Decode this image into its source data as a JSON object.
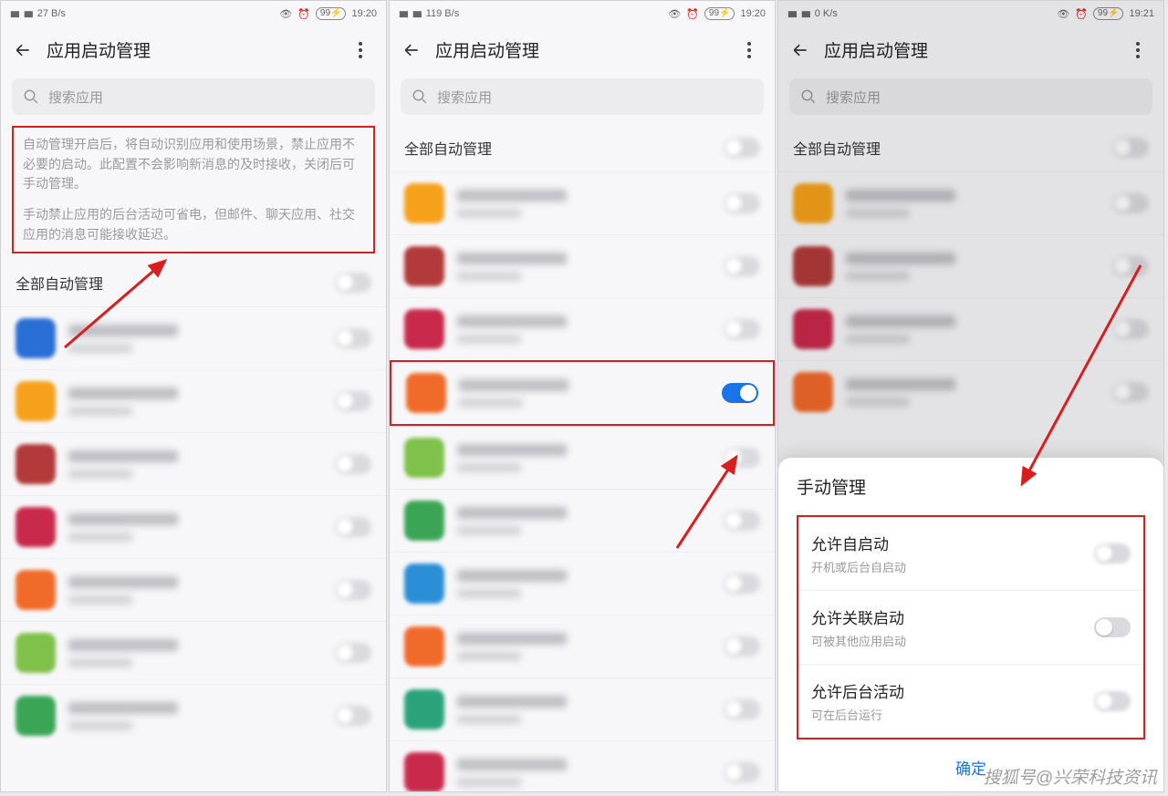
{
  "statusbar": {
    "net_speed_a": "27 B/s",
    "net_speed_b": "119 B/s",
    "net_speed_c": "0 K/s",
    "battery": "99",
    "time_a": "19:20",
    "time_b": "19:20",
    "time_c": "19:21"
  },
  "header": {
    "title": "应用启动管理"
  },
  "search": {
    "placeholder": "搜索应用"
  },
  "info": {
    "p1": "自动管理开启后，将自动识别应用和使用场景，禁止应用不必要的启动。此配置不会影响新消息的及时接收，关闭后可手动管理。",
    "p2": "手动禁止应用的后台活动可省电，但邮件、聊天应用、社交应用的消息可能接收延迟。"
  },
  "section": {
    "all_auto": "全部自动管理"
  },
  "sheet": {
    "title": "手动管理",
    "opt1_t": "允许自启动",
    "opt1_d": "开机或后台自启动",
    "opt2_t": "允许关联启动",
    "opt2_d": "可被其他应用启动",
    "opt3_t": "允许后台活动",
    "opt3_d": "可在后台运行",
    "confirm": "确定"
  },
  "watermark": "搜狐号@兴荣科技资讯",
  "app_colors_a": [
    "#2a6fd6",
    "#f6a11b",
    "#b23a3a",
    "#c92a4b",
    "#f06a2a",
    "#7fc14a",
    "#3aa655"
  ],
  "app_colors_b": [
    "#f6a11b",
    "#b23a3a",
    "#c92a4b",
    "#f06a2a",
    "#7fc14a",
    "#3aa655",
    "#2a8fd6",
    "#f06a2a",
    "#2aa37a",
    "#c92a4b"
  ],
  "app_colors_c": [
    "#f6a11b",
    "#b23a3a",
    "#c92a4b",
    "#f06a2a"
  ]
}
